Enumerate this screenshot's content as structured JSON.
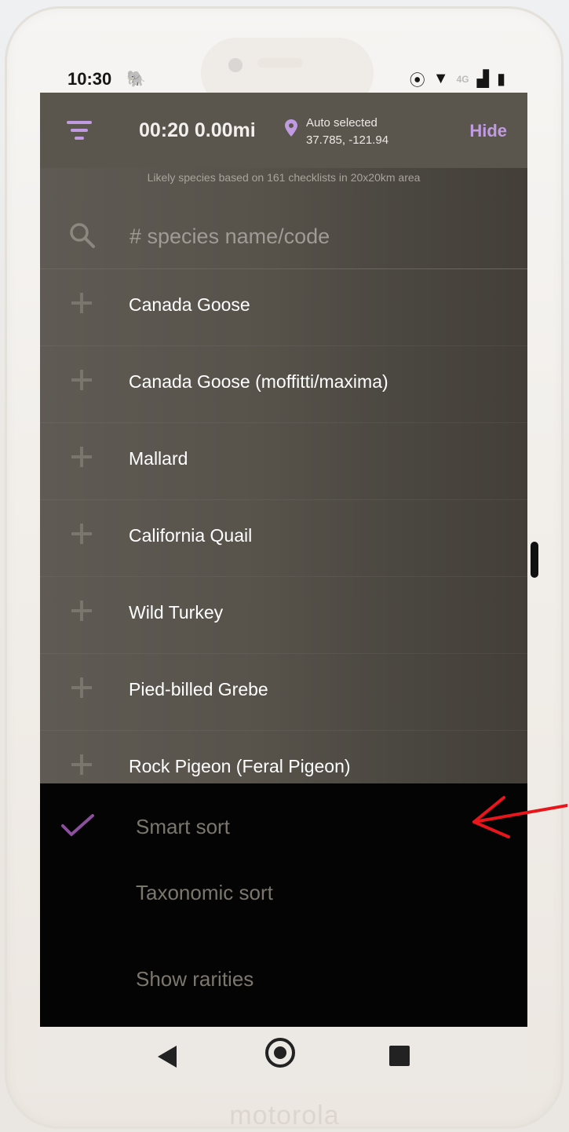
{
  "device": {
    "brand": "motorola"
  },
  "status_bar": {
    "time": "10:30",
    "network": "4G"
  },
  "header": {
    "timer": "00:20 0.00mi",
    "location_label": "Auto selected",
    "location_coords": "37.785, -121.94",
    "hide_label": "Hide",
    "accent_color": "#c19be2"
  },
  "info_line": "Likely species based on 161 checklists in 20x20km area",
  "search": {
    "placeholder": "# species name/code"
  },
  "species": [
    "Canada Goose",
    "Canada Goose (moffitti/maxima)",
    "Mallard",
    "California Quail",
    "Wild Turkey",
    "Pied-billed Grebe",
    "Rock Pigeon (Feral Pigeon)"
  ],
  "sort_menu": {
    "items": [
      {
        "label": "Smart sort",
        "checked": true
      },
      {
        "label": "Taxonomic sort",
        "checked": false
      },
      {
        "label": "Show rarities",
        "checked": false
      }
    ]
  },
  "annotation": {
    "arrow_color": "#e8151b"
  }
}
